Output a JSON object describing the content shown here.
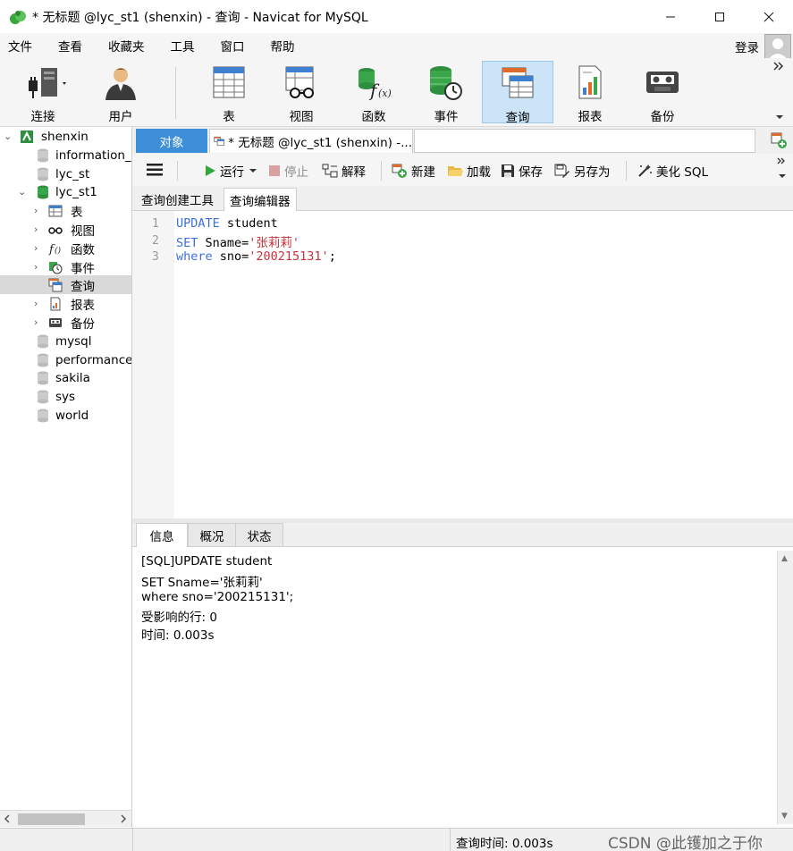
{
  "window": {
    "title": "* 无标题 @lyc_st1 (shenxin) - 查询 - Navicat for MySQL"
  },
  "menu": {
    "items": [
      "文件",
      "查看",
      "收藏夹",
      "工具",
      "窗口",
      "帮助"
    ],
    "login": "登录"
  },
  "toolbar": {
    "connect": "连接",
    "user": "用户",
    "table": "表",
    "view": "视图",
    "function": "函数",
    "event": "事件",
    "query": "查询",
    "report": "报表",
    "backup": "备份"
  },
  "tree": {
    "connection": "shenxin",
    "db_information": "information_",
    "db_lyc_st": "lyc_st",
    "db_lyc_st1": "lyc_st1",
    "node_table": "表",
    "node_view": "视图",
    "node_function": "函数",
    "node_event": "事件",
    "node_query": "查询",
    "node_report": "报表",
    "node_backup": "备份",
    "db_mysql": "mysql",
    "db_performance": "performance",
    "db_sakila": "sakila",
    "db_sys": "sys",
    "db_world": "world"
  },
  "tabs": {
    "objects": "对象",
    "query_tab": "* 无标题 @lyc_st1 (shenxin) -..."
  },
  "query_toolbar": {
    "run": "运行",
    "stop": "停止",
    "explain": "解释",
    "new": "新建",
    "load": "加载",
    "save": "保存",
    "save_as": "另存为",
    "beautify": "美化 SQL"
  },
  "subtabs": {
    "builder": "查询创建工具",
    "editor": "查询编辑器"
  },
  "editor": {
    "line_numbers": [
      "1",
      "2",
      "3"
    ],
    "line1_kw": "UPDATE",
    "line1_rest": " student",
    "line2_kw": "SET",
    "line2_mid": " Sname=",
    "line2_str": "'张莉莉'",
    "line3_kw": "where",
    "line3_mid": " sno=",
    "line3_str": "'200215131'",
    "line3_end": ";"
  },
  "info_tabs": {
    "info": "信息",
    "profile": "概况",
    "status": "状态"
  },
  "info_panel": {
    "lines": [
      "[SQL]UPDATE student",
      "SET Sname='张莉莉'",
      "where sno='200215131';",
      "受影响的行: 0",
      "时间: 0.003s"
    ]
  },
  "statusbar": {
    "query_time": "查询时间: 0.003s",
    "watermark": "CSDN @此镬加之于你"
  },
  "colors": {
    "accent_blue": "#3c8fd8",
    "keyword": "#3e6fd8",
    "string": "#c8323a",
    "active_tool": "#cce4f7"
  }
}
